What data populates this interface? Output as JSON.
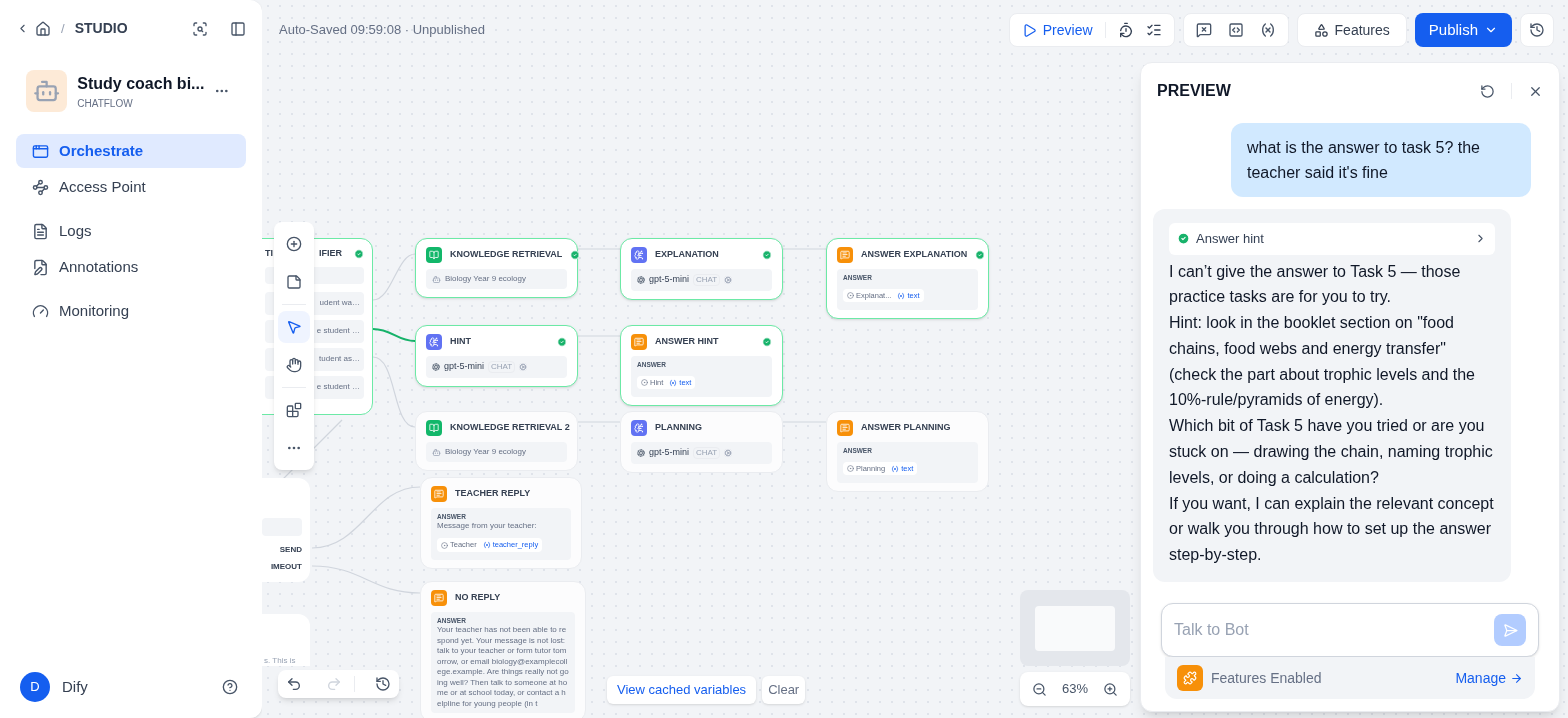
{
  "sidebar": {
    "separator": "/",
    "breadcrumb": "STUDIO",
    "app": {
      "name": "Study coach bi...",
      "type": "CHATFLOW"
    },
    "nav": [
      {
        "label": "Orchestrate",
        "selected": true
      },
      {
        "label": "Access Point",
        "selected": false
      },
      {
        "label": "Logs",
        "selected": false
      },
      {
        "label": "Annotations",
        "selected": false
      },
      {
        "label": "Monitoring",
        "selected": false
      }
    ],
    "user": {
      "initial": "D",
      "name": "Dify"
    }
  },
  "status": "Auto-Saved 09:59:08 · Unpublished",
  "toolbar": {
    "preview": "Preview",
    "features": "Features",
    "publish": "Publish"
  },
  "canvas": {
    "tools": [
      {
        "kind": "add",
        "selected": false
      },
      {
        "kind": "note",
        "selected": false
      },
      {
        "kind": "pointer",
        "selected": true
      },
      {
        "kind": "hand",
        "selected": false
      },
      {
        "kind": "blocks",
        "selected": false
      },
      {
        "kind": "more",
        "selected": false
      }
    ],
    "classifier": {
      "title_left": "TI",
      "title_right": "IFIER",
      "done": true,
      "rows": [
        {
          "right": "udent wa…"
        },
        {
          "right": "e student …"
        },
        {
          "right": "tudent as…"
        },
        {
          "right": "e student …"
        }
      ]
    },
    "branch_node": {
      "ports": [
        "SEND",
        "IMEOUT"
      ]
    },
    "note_node": {
      "text": "s. This is"
    },
    "nodes": [
      {
        "kind": "knowledge",
        "title": "KNOWLEDGE RETRIEVAL",
        "done": true,
        "dataset": "Biology Year 9 ecology"
      },
      {
        "kind": "llm",
        "title": "EXPLANATION",
        "done": true,
        "model": "gpt-5-mini",
        "badge": "CHAT"
      },
      {
        "kind": "answer",
        "title": "ANSWER EXPLANATION",
        "done": true,
        "label": "ANSWER",
        "source": "Explanat...",
        "variable": "text"
      },
      {
        "kind": "llm",
        "title": "HINT",
        "done": true,
        "model": "gpt-5-mini",
        "badge": "CHAT"
      },
      {
        "kind": "answer",
        "title": "ANSWER HINT",
        "done": true,
        "label": "ANSWER",
        "source": "Hint",
        "variable": "text"
      },
      {
        "kind": "knowledge",
        "title": "KNOWLEDGE RETRIEVAL 2",
        "done": false,
        "dataset": "Biology Year 9 ecology"
      },
      {
        "kind": "llm",
        "title": "PLANNING",
        "done": false,
        "model": "gpt-5-mini",
        "badge": "CHAT"
      },
      {
        "kind": "answer",
        "title": "ANSWER PLANNING",
        "done": false,
        "label": "ANSWER",
        "source": "Planning",
        "variable": "text"
      },
      {
        "kind": "answer",
        "title": "TEACHER REPLY",
        "done": false,
        "label": "ANSWER",
        "message": "Message from your teacher:",
        "source": "Teacher",
        "variable": "teacher_reply"
      },
      {
        "kind": "answer",
        "title": "NO REPLY",
        "done": false,
        "label": "ANSWER",
        "message": "Your teacher has not been able to respond yet. Your message is not lost: talk to your teacher or form tutor tomorrow, or email biology@examplecollege.example. Are things really not going well? Then talk to someone at home or at school today, or contact a helpline for young people (in t"
      }
    ],
    "cached": "View cached variables",
    "clear": "Clear",
    "zoom": "63%"
  },
  "preview": {
    "title": "PREVIEW",
    "user_message": "what is the answer to task 5? the teacher said it's fine",
    "hint": {
      "label": "Answer hint",
      "done": true
    },
    "reply": [
      "I can’t give the answer to Task 5 — those practice tasks are for you to try.",
      "Hint: look in the booklet section on \"food chains, food webs and energy transfer\" (check the part about trophic levels and the 10%-rule/pyramids of energy).",
      "Which bit of Task 5 have you tried or are you stuck on — drawing the chain, naming trophic levels, or doing a calculation?",
      "If you want, I can explain the relevant concept or walk you through how to set up the answer step-by-step."
    ],
    "input": {
      "placeholder": "Talk to Bot"
    },
    "features": {
      "label": "Features Enabled",
      "manage": "Manage"
    }
  }
}
